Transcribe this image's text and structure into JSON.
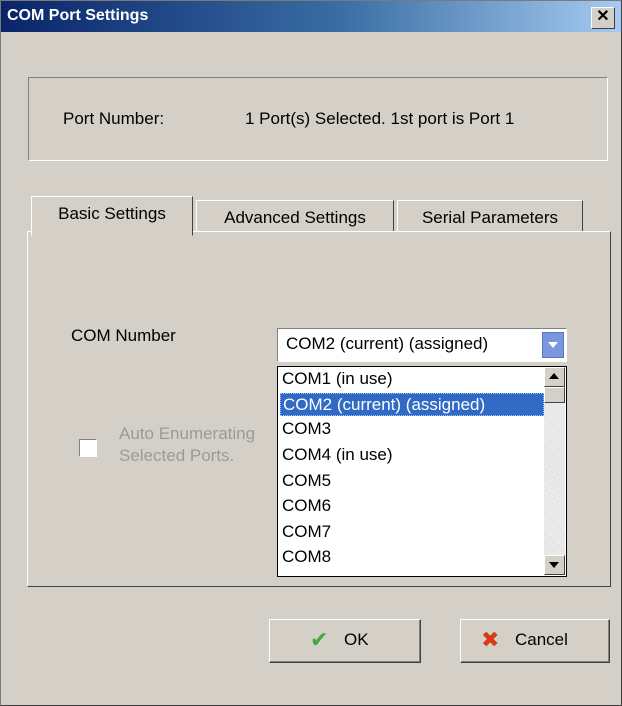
{
  "window": {
    "title": "COM Port Settings",
    "close_glyph": "✕"
  },
  "port": {
    "label": "Port Number:",
    "value": "1 Port(s) Selected. 1st port is Port 1"
  },
  "tabs": [
    {
      "label": "Basic Settings"
    },
    {
      "label": "Advanced Settings"
    },
    {
      "label": "Serial Parameters"
    }
  ],
  "basic": {
    "com_label": "COM Number",
    "com_selected": "COM2 (current) (assigned)",
    "auto_enum_line1": "Auto Enumerating",
    "auto_enum_line2": "Selected Ports.",
    "options": [
      "COM1 (in use)",
      "COM2 (current) (assigned)",
      "COM3",
      "COM4 (in use)",
      "COM5",
      "COM6",
      "COM7",
      "COM8"
    ]
  },
  "buttons": {
    "ok": "OK",
    "cancel": "Cancel"
  },
  "icons": {
    "ok": "check-icon",
    "cancel": "x-icon",
    "ok_color": "#3caa3c",
    "cancel_color": "#d83a1a"
  }
}
